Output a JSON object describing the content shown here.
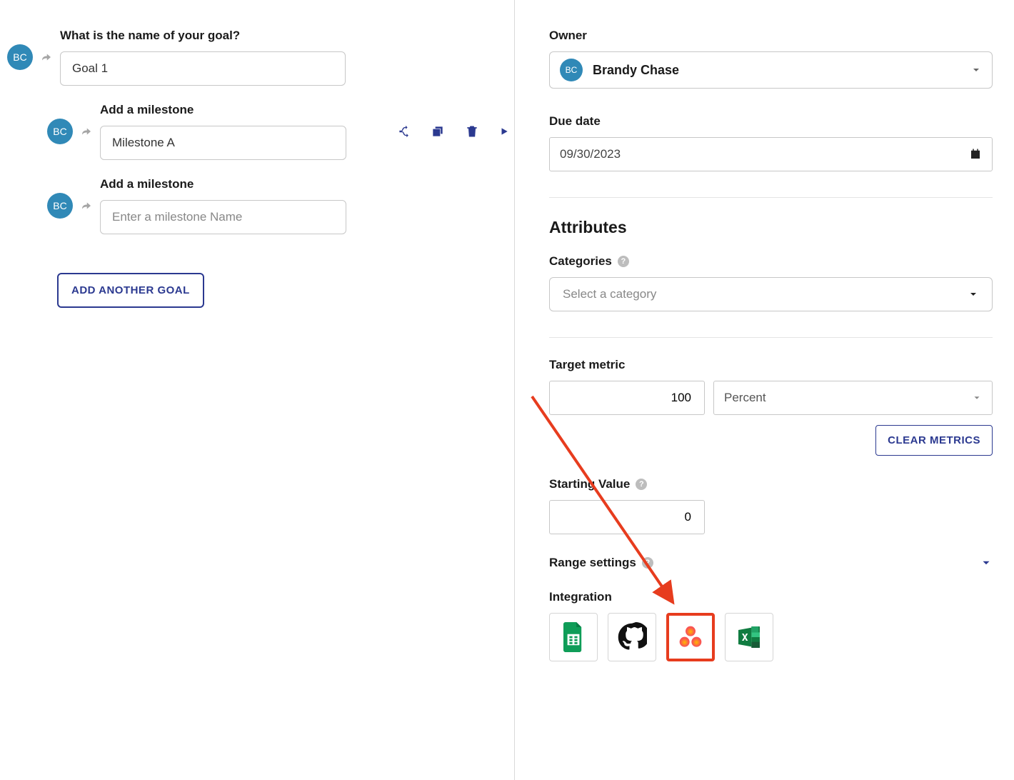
{
  "goal": {
    "name_label": "What is the name of your goal?",
    "name_value": "Goal 1",
    "avatar_initials": "BC"
  },
  "milestones": [
    {
      "label": "Add a milestone",
      "value": "Milestone A",
      "placeholder": ""
    },
    {
      "label": "Add a milestone",
      "value": "",
      "placeholder": "Enter a milestone Name"
    }
  ],
  "add_another_goal": "ADD ANOTHER GOAL",
  "owner": {
    "label": "Owner",
    "name": "Brandy Chase",
    "initials": "BC"
  },
  "due_date": {
    "label": "Due date",
    "value": "09/30/2023"
  },
  "attributes": {
    "title": "Attributes",
    "categories_label": "Categories",
    "categories_placeholder": "Select a category"
  },
  "target_metric": {
    "label": "Target metric",
    "value": "100",
    "unit": "Percent",
    "clear_label": "CLEAR METRICS"
  },
  "starting_value": {
    "label": "Starting Value",
    "value": "0"
  },
  "range_settings_label": "Range settings",
  "integration": {
    "label": "Integration",
    "items": [
      "google-sheets",
      "github",
      "asana",
      "excel"
    ]
  }
}
